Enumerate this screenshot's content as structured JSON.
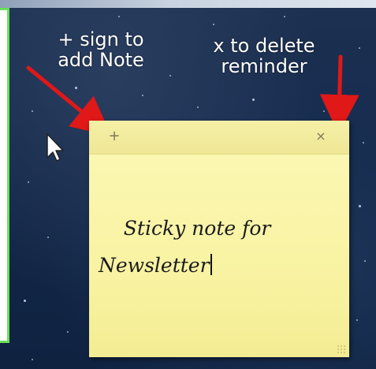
{
  "annotations": {
    "add_note": "+ sign to\nadd Note",
    "delete_reminder": "x to delete\nreminder"
  },
  "note": {
    "add_button": "+",
    "delete_button": "×",
    "text": "Sticky note for\nNewsletter"
  },
  "colors": {
    "note_background": "#f8f2a0",
    "arrow": "#e01818",
    "frame_border": "#69e05a",
    "desktop_background": "#14284a"
  },
  "icons": {
    "cursor": "mouse-pointer-icon",
    "add": "plus-icon",
    "delete": "close-icon"
  }
}
